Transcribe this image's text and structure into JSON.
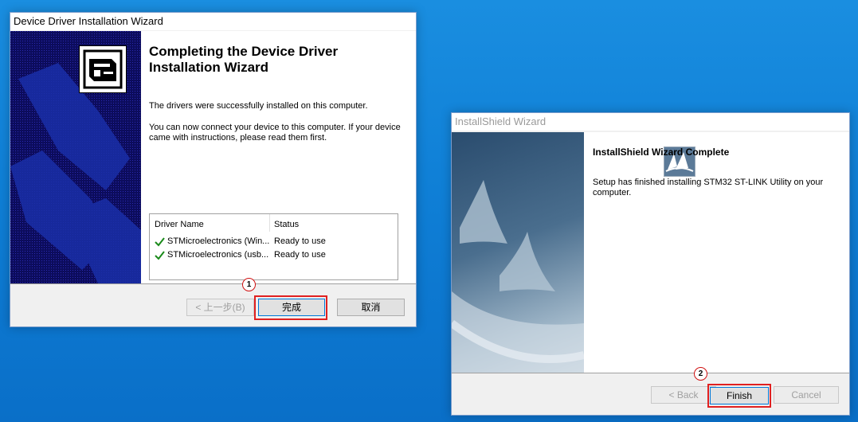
{
  "ddw": {
    "title": "Device Driver Installation Wizard",
    "heading_line1": "Completing the Device Driver",
    "heading_line2": "Installation Wizard",
    "para1": "The drivers were successfully installed on this computer.",
    "para2_line1": "You can now connect your device to this computer. If your device",
    "para2_line2": "came with instructions, please read them first.",
    "table": {
      "col_driver": "Driver Name",
      "col_status": "Status",
      "rows": [
        {
          "name": "STMicroelectronics (Win...",
          "status": "Ready to use"
        },
        {
          "name": "STMicroelectronics (usb...",
          "status": "Ready to use"
        }
      ]
    },
    "back_label": "< 上一步(B)",
    "finish_label": "完成",
    "cancel_label": "取消",
    "marker": "1"
  },
  "isw": {
    "title": "InstallShield Wizard",
    "heading": "InstallShield Wizard Complete",
    "para_line1": "Setup has finished installing STM32 ST-LINK Utility on your",
    "para_line2": "computer.",
    "back_label": "< Back",
    "finish_label": "Finish",
    "cancel_label": "Cancel",
    "marker": "2"
  }
}
